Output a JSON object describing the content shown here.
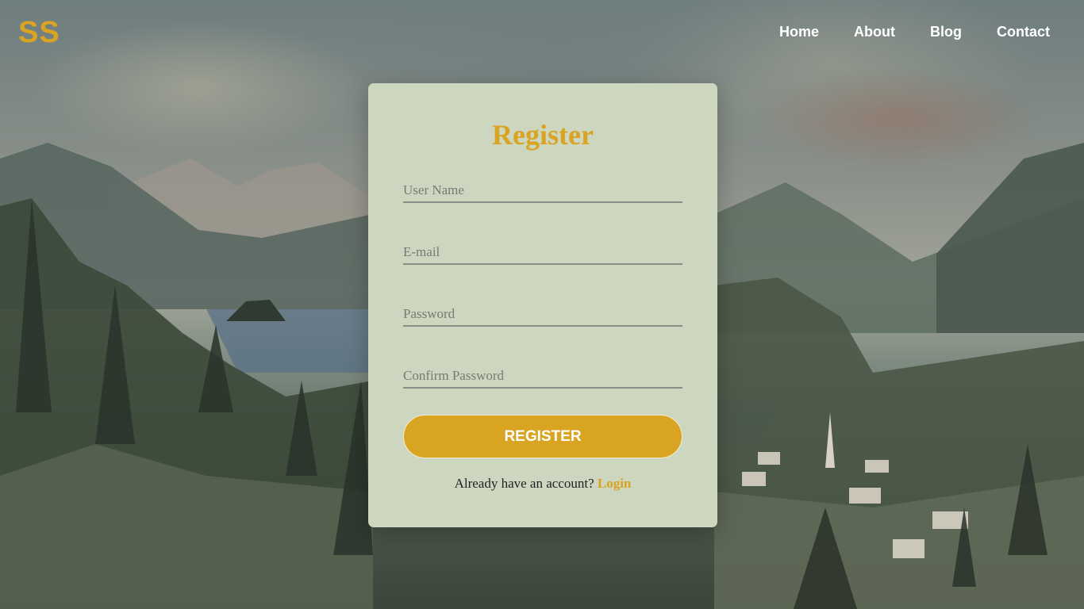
{
  "brand": {
    "logo": "SS"
  },
  "nav": {
    "home": "Home",
    "about": "About",
    "blog": "Blog",
    "contact": "Contact"
  },
  "register": {
    "title": "Register",
    "username_placeholder": "User Name",
    "email_placeholder": "E-mail",
    "password_placeholder": "Password",
    "confirm_placeholder": "Confirm Password",
    "submit_label": "REGISTER",
    "login_prompt": "Already have an account?",
    "login_link": "Login"
  },
  "colors": {
    "accent": "#d9a421",
    "card": "#cdd6bf",
    "nav_text": "#ffffff"
  }
}
